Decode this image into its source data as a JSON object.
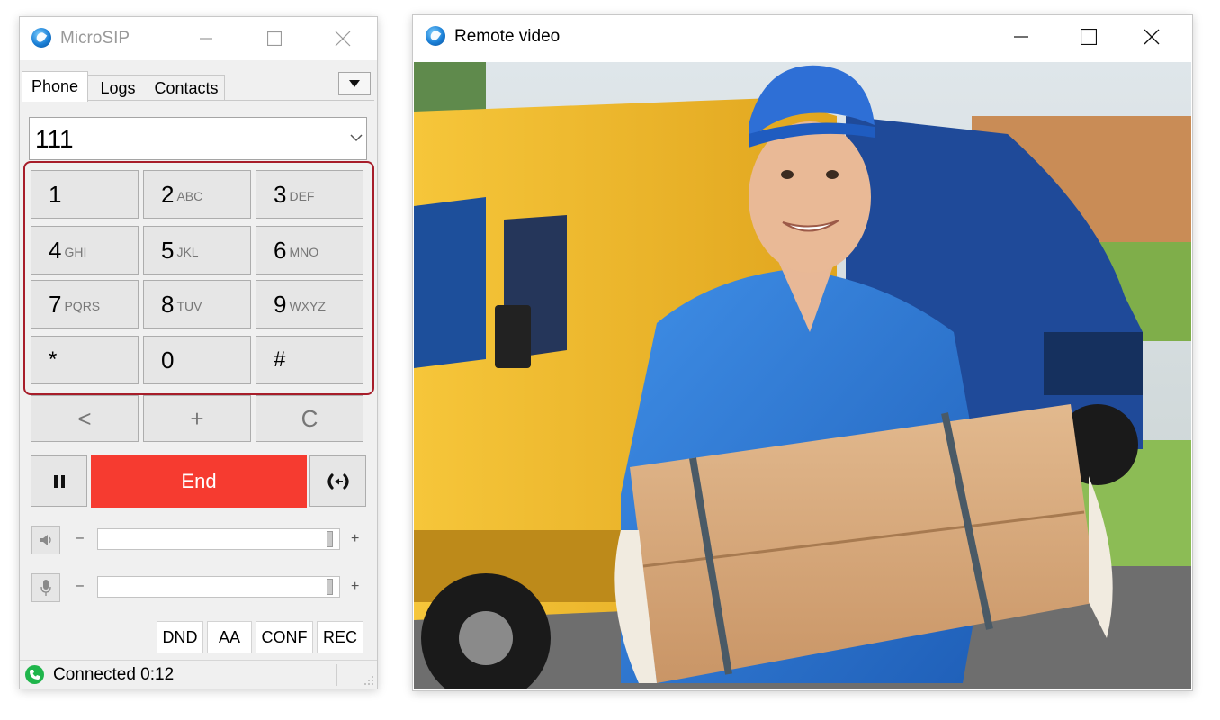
{
  "microsip": {
    "title": "MicroSIP",
    "tabs": [
      "Phone",
      "Logs",
      "Contacts"
    ],
    "number": "111",
    "keypad": [
      {
        "digit": "1",
        "letters": ""
      },
      {
        "digit": "2",
        "letters": "ABC"
      },
      {
        "digit": "3",
        "letters": "DEF"
      },
      {
        "digit": "4",
        "letters": "GHI"
      },
      {
        "digit": "5",
        "letters": "JKL"
      },
      {
        "digit": "6",
        "letters": "MNO"
      },
      {
        "digit": "7",
        "letters": "PQRS"
      },
      {
        "digit": "8",
        "letters": "TUV"
      },
      {
        "digit": "9",
        "letters": "WXYZ"
      },
      {
        "digit": "*",
        "letters": ""
      },
      {
        "digit": "0",
        "letters": ""
      },
      {
        "digit": "#",
        "letters": ""
      }
    ],
    "function_keys": [
      "<",
      "+",
      "C"
    ],
    "end_label": "End",
    "hold_icon": "pause-icon",
    "transfer_icon": "transfer-icon",
    "speaker": {
      "minus": "–",
      "plus": "+",
      "level": 0.98
    },
    "microphone": {
      "minus": "–",
      "plus": "+",
      "level": 0.98
    },
    "options": [
      "DND",
      "AA",
      "CONF",
      "REC"
    ],
    "status": "Connected 0:12",
    "colors": {
      "end_button": "#f63b30",
      "keypad_highlight": "#a71d2a",
      "status_ok": "#1fb54b"
    }
  },
  "remote": {
    "title": "Remote video"
  }
}
